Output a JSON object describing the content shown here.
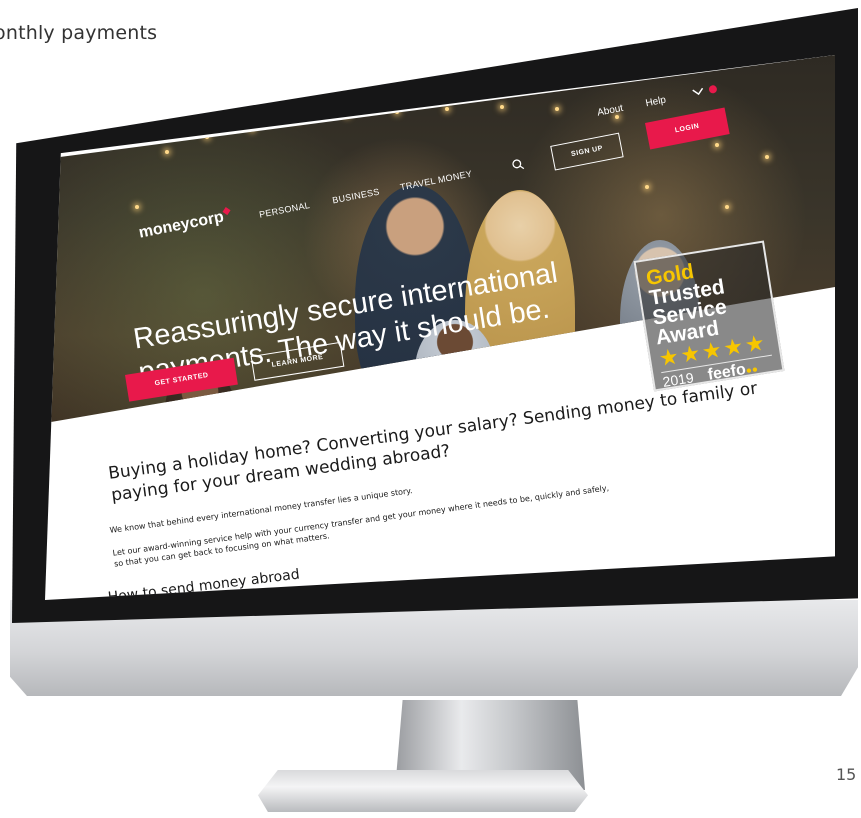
{
  "document": {
    "heading_fragment": "onthly payments",
    "page_number": "15"
  },
  "site": {
    "logo": "moneycorp",
    "top_links": [
      "About",
      "Help"
    ],
    "nav": [
      "PERSONAL",
      "BUSINESS",
      "TRAVEL MONEY"
    ],
    "sign_up_label": "SIGN UP",
    "login_label": "LOGIN",
    "hero": {
      "title_line1": "Reassuringly secure international",
      "title_line2": "payments. The way it should be.",
      "get_started_label": "GET STARTED",
      "learn_more_label": "LEARN MORE"
    },
    "award": {
      "line1": "Gold",
      "line2": "Trusted",
      "line3": "Service",
      "line4": "Award",
      "stars": "★★★★★",
      "year": "2019",
      "brand": "feefo"
    },
    "content": {
      "heading_line1": "Buying a holiday home? Converting your salary? Sending money to family or",
      "heading_line2": "paying for your dream wedding abroad?",
      "para1": "We know that behind every international money transfer lies a unique story.",
      "para2_line1": "Let our award-winning service help with your currency transfer and get your money where it needs to be, quickly and safely,",
      "para2_line2": "so that you can get back to focusing on what matters.",
      "subheading": "How to send money abroad"
    }
  },
  "colors": {
    "brand_accent": "#e8194b",
    "award_gold": "#f7c600"
  },
  "icons": {
    "search": "search-icon",
    "language": "chevron-down-icon"
  }
}
